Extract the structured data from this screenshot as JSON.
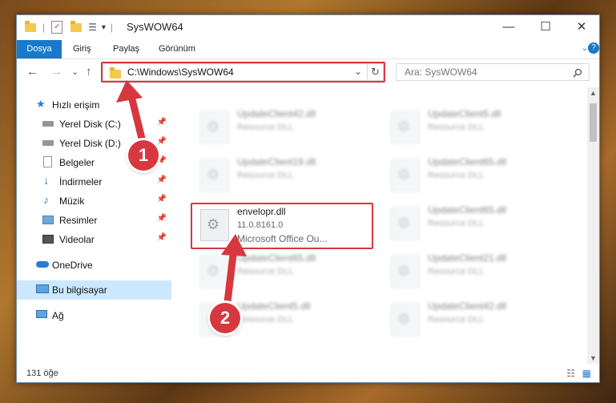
{
  "window": {
    "title": "SysWOW64",
    "controls": {
      "minimize": "—",
      "maximize": "☐",
      "close": "✕"
    }
  },
  "ribbon": {
    "tabs": [
      "Dosya",
      "Giriş",
      "Paylaş",
      "Görünüm"
    ]
  },
  "address": {
    "path": "C:\\Windows\\SysWOW64",
    "refresh": "↻",
    "dropdown": "⌄"
  },
  "search": {
    "placeholder": "Ara: SysWOW64",
    "icon": "search-icon"
  },
  "nav": {
    "back": "←",
    "forward": "→",
    "recent": "⌄",
    "up": "↑",
    "items": [
      {
        "label": "Hızlı erişim",
        "icon": "star-icon",
        "pinned": false
      },
      {
        "label": "Yerel Disk (C:)",
        "icon": "drive-icon",
        "pinned": true
      },
      {
        "label": "Yerel Disk (D:)",
        "icon": "drive-icon",
        "pinned": true
      },
      {
        "label": "Belgeler",
        "icon": "documents-icon",
        "pinned": true
      },
      {
        "label": "İndirmeler",
        "icon": "download-icon",
        "pinned": true
      },
      {
        "label": "Müzik",
        "icon": "music-icon",
        "pinned": true
      },
      {
        "label": "Resimler",
        "icon": "pictures-icon",
        "pinned": true
      },
      {
        "label": "Videolar",
        "icon": "video-icon",
        "pinned": true
      },
      {
        "label": "OneDrive",
        "icon": "cloud-icon",
        "pinned": false
      },
      {
        "label": "Bu bilgisayar",
        "icon": "computer-icon",
        "pinned": false
      },
      {
        "label": "Ağ",
        "icon": "network-icon",
        "pinned": false
      }
    ]
  },
  "files": {
    "highlighted": {
      "name": "envelopr.dll",
      "version": "11.0.8161.0",
      "company": "Microsoft Office Ou..."
    },
    "blurred": [
      {
        "name": "UpdateClient42.dll",
        "type": "Resource DLL"
      },
      {
        "name": "UpdateClient5.dll",
        "type": "Resource DLL"
      },
      {
        "name": "UpdateClient19.dll",
        "type": "Resource DLL"
      },
      {
        "name": "UpdateClient65.dll",
        "type": "Resource DLL"
      },
      {
        "name": "UpdateClient65.dll",
        "type": "Resource DLL"
      },
      {
        "name": "UpdateClient65.dll",
        "type": "Resource DLL"
      },
      {
        "name": "UpdateClient21.dll",
        "type": "Resource DLL"
      },
      {
        "name": "UpdateClient5.dll",
        "type": "Resource DLL"
      },
      {
        "name": "UpdateClient42.dll",
        "type": "Resource DLL"
      }
    ]
  },
  "status": {
    "count": "131 öğe"
  },
  "callouts": [
    "1",
    "2"
  ],
  "colors": {
    "accent": "#1979ca",
    "highlight": "#d7373f",
    "selected": "#cce8ff"
  }
}
